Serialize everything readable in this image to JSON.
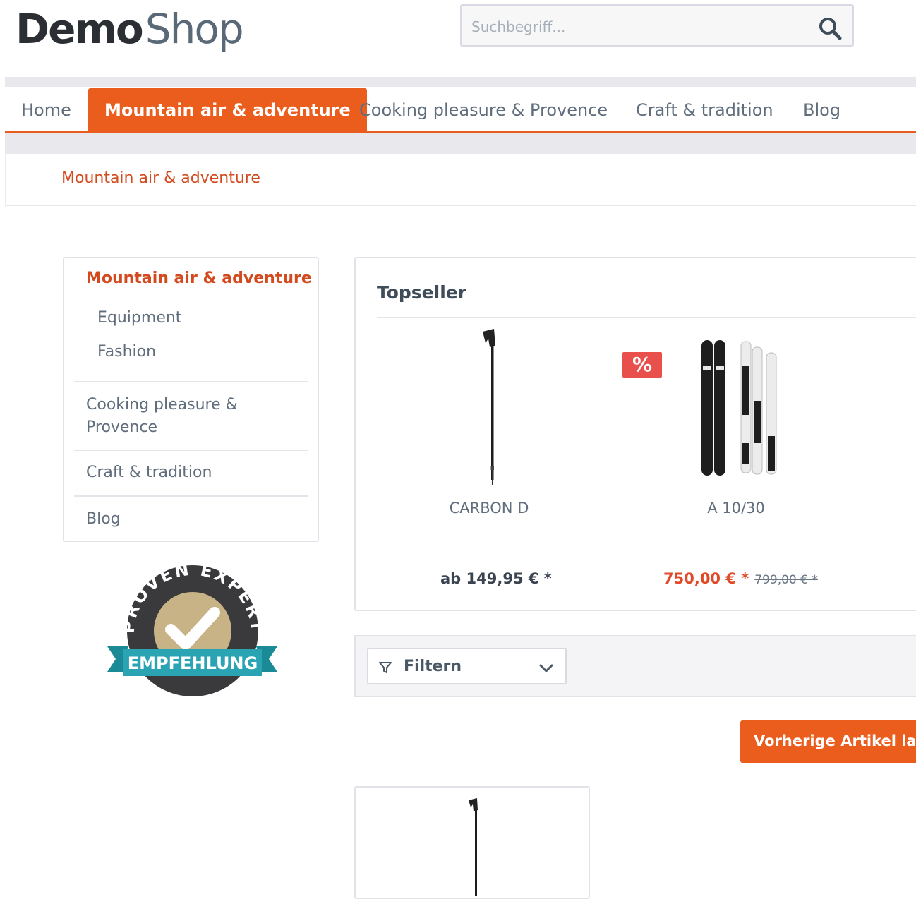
{
  "header": {
    "logo_bold": "Demo",
    "logo_light": "Shop",
    "search_placeholder": "Suchbegriff..."
  },
  "nav": {
    "items": [
      {
        "label": "Home"
      },
      {
        "label": "Mountain air & adventure",
        "active": true
      },
      {
        "label": "Cooking pleasure & Provence"
      },
      {
        "label": "Craft & tradition"
      },
      {
        "label": "Blog"
      }
    ]
  },
  "breadcrumb": "Mountain air & adventure",
  "sidebar": {
    "heading": "Mountain air & adventure",
    "subitems": [
      "Equipment",
      "Fashion"
    ],
    "links": [
      "Cooking pleasure & Provence",
      "Craft & tradition",
      "Blog"
    ]
  },
  "badge": {
    "top_text": "PROVEN EXPERT",
    "ribbon_text": "EMPFEHLUNG"
  },
  "topseller": {
    "title": "Topseller",
    "products": [
      {
        "name": "CARBON D",
        "price": "ab 149,95 € *",
        "image": "ski-pole-image"
      },
      {
        "name": "A 10/30",
        "price": "750,00 € *",
        "old_price": "799,00 € *",
        "sale_badge": "%",
        "image": "skis-image"
      }
    ]
  },
  "filter": {
    "label": "Filtern"
  },
  "load_prev": {
    "label": "Vorherige Artikel laden"
  },
  "colors": {
    "accent": "#ea5d1d",
    "sale": "#e9504c",
    "text": "#5f6d7c"
  }
}
